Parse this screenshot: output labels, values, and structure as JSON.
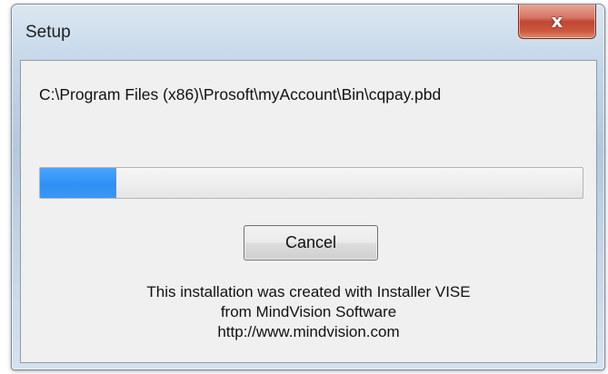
{
  "window": {
    "title": "Setup",
    "close_glyph": "x"
  },
  "install": {
    "current_file": "C:\\Program Files (x86)\\Prosoft\\myAccount\\Bin\\cqpay.pbd",
    "progress_fraction": 0.14
  },
  "buttons": {
    "cancel_label": "Cancel"
  },
  "credits": {
    "line1": "This installation was created with Installer VISE",
    "line2": "from MindVision Software",
    "line3": "http://www.mindvision.com"
  },
  "colors": {
    "progress_fill": "#2f8ff4",
    "close_button": "#c24633"
  }
}
